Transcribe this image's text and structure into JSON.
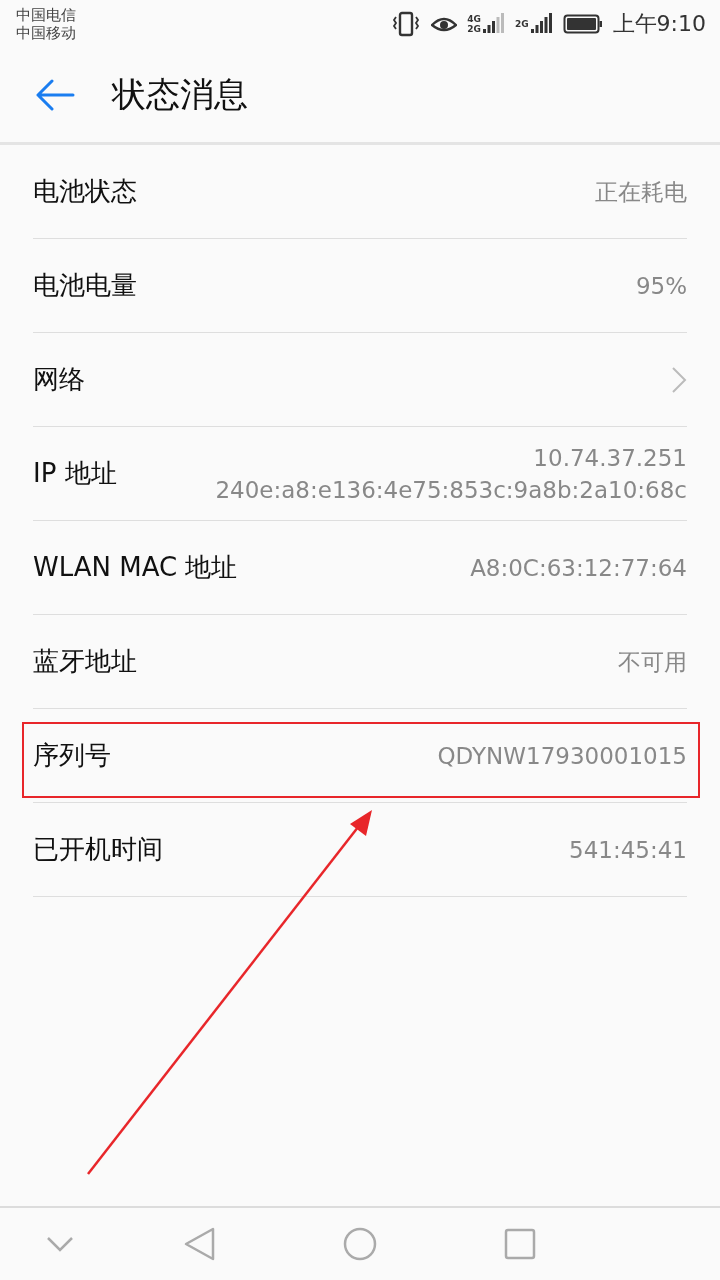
{
  "status_bar": {
    "carriers": [
      "中国电信",
      "中国移动"
    ],
    "sim1_labels": [
      "4G",
      "2G"
    ],
    "sim2_label": "2G",
    "time": "上午9:10"
  },
  "header": {
    "title": "状态消息"
  },
  "rows": [
    {
      "kind": "value",
      "label": "电池状态",
      "values": [
        "正在耗电"
      ],
      "highlighted": false
    },
    {
      "kind": "value",
      "label": "电池电量",
      "values": [
        "95%"
      ],
      "highlighted": false
    },
    {
      "kind": "link",
      "label": "网络",
      "highlighted": false
    },
    {
      "kind": "value",
      "label": "IP 地址",
      "values": [
        "10.74.37.251",
        "240e:a8:e136:4e75:853c:9a8b:2a10:68c"
      ],
      "highlighted": false
    },
    {
      "kind": "value",
      "label": "WLAN MAC 地址",
      "values": [
        "A8:0C:63:12:77:64"
      ],
      "highlighted": false
    },
    {
      "kind": "value",
      "label": "蓝牙地址",
      "values": [
        "不可用"
      ],
      "highlighted": false
    },
    {
      "kind": "value",
      "label": "序列号",
      "values": [
        "QDYNW17930001015"
      ],
      "highlighted": true
    },
    {
      "kind": "value",
      "label": "已开机时间",
      "values": [
        "541:45:41"
      ],
      "highlighted": false
    }
  ]
}
